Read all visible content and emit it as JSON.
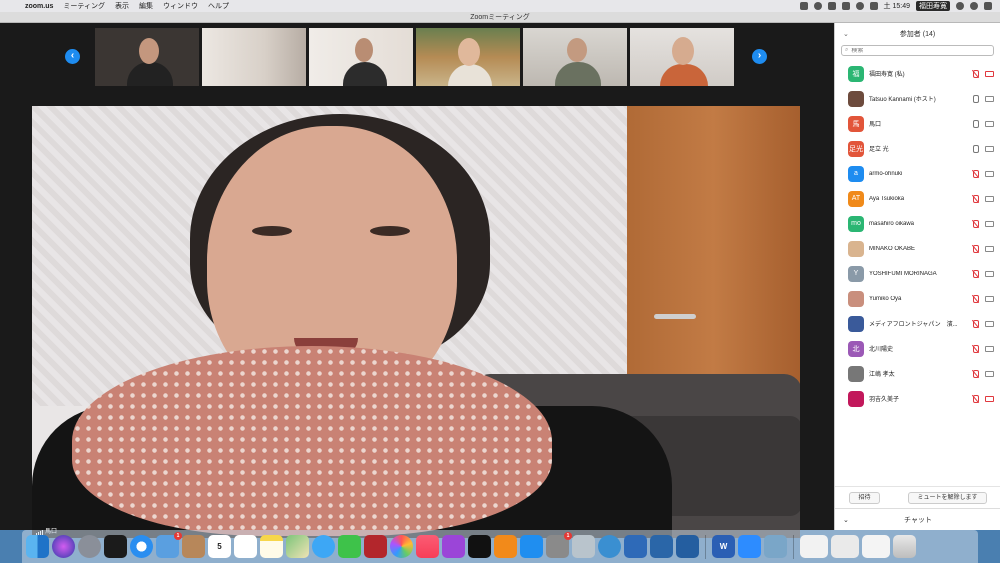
{
  "menubar": {
    "app_name": "zoom.us",
    "menus": [
      "ミーティング",
      "表示",
      "編集",
      "ウィンドウ",
      "ヘルプ"
    ],
    "time": "土 15:49",
    "user": "福田寿寛"
  },
  "window": {
    "title": "Zoomミーティング"
  },
  "main_video": {
    "speaker_name": "馬口"
  },
  "panel": {
    "title": "参加者 (14)",
    "search_placeholder": "検索",
    "participants": [
      {
        "avatar": "福",
        "color": "#2bb673",
        "name": "福田寿寛 (私)",
        "mic": "muted",
        "video": "off"
      },
      {
        "avatar": "",
        "color": "#6d4b3d",
        "name": "Tatsuo Kannami (ホスト)",
        "mic": "on",
        "video": "on"
      },
      {
        "avatar": "馬",
        "color": "#e2553a",
        "name": "馬口",
        "mic": "on",
        "video": "on"
      },
      {
        "avatar": "足光",
        "color": "#e2553a",
        "name": "足立 光",
        "mic": "on",
        "video": "on"
      },
      {
        "avatar": "a",
        "color": "#1e8cf0",
        "name": "armo-ohnuki",
        "mic": "muted",
        "video": "on"
      },
      {
        "avatar": "AT",
        "color": "#f08a1a",
        "name": "Aya Tsukioka",
        "mic": "muted",
        "video": "on"
      },
      {
        "avatar": "mo",
        "color": "#2bb673",
        "name": "masahiro oikawa",
        "mic": "muted",
        "video": "on"
      },
      {
        "avatar": "",
        "color": "#d9b48f",
        "name": "MINAKO OKABE",
        "mic": "muted",
        "video": "on"
      },
      {
        "avatar": "Y",
        "color": "#8a9aa8",
        "name": "YOSHIFUMI MORINAGA",
        "mic": "muted",
        "video": "on"
      },
      {
        "avatar": "",
        "color": "#c98f7d",
        "name": "Yumiko Oya",
        "mic": "muted",
        "video": "on"
      },
      {
        "avatar": "",
        "color": "#3a5a9a",
        "name": "メディアフロントジャパン　濱...",
        "mic": "muted",
        "video": "on"
      },
      {
        "avatar": "北",
        "color": "#9b59b6",
        "name": "北川陽史",
        "mic": "muted",
        "video": "on"
      },
      {
        "avatar": "",
        "color": "#777777",
        "name": "江嶋 孝太",
        "mic": "muted",
        "video": "on"
      },
      {
        "avatar": "",
        "color": "#c2185b",
        "name": "羽吉久美子",
        "mic": "muted",
        "video": "off"
      }
    ],
    "invite_label": "招待",
    "unmute_label": "ミュートを解除します",
    "chat_label": "チャット"
  },
  "dock": {
    "calendar_day": "5",
    "badges": {
      "mail": "1",
      "settings": "1"
    }
  }
}
